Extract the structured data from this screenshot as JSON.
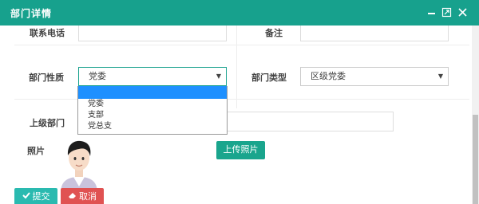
{
  "dialog": {
    "title": "部门详情"
  },
  "form": {
    "phone_label": "联系电话",
    "phone_value": "",
    "remark_label": "备注",
    "remark_value": "",
    "nature_label": "部门性质",
    "nature_selected": "党委",
    "nature_options": [
      "",
      "党委",
      "支部",
      "党总支"
    ],
    "type_label": "部门类型",
    "type_selected": "区级党委",
    "parent_label": "上级部门",
    "parent_value": "",
    "photo_label": "照片",
    "upload_label": "上传照片",
    "submit_label": "提交",
    "cancel_label": "取消"
  },
  "colors": {
    "titlebar": "#17a18d",
    "upload_button": "#1aa58d",
    "submit_button": "#2abab0",
    "cancel_button": "#e05252",
    "dropdown_highlight": "#1e90ff"
  },
  "icons": {
    "minimize": "minimize-icon",
    "maximize": "maximize-icon",
    "close": "close-icon",
    "submit": "check-icon",
    "cancel": "eraser-icon"
  }
}
